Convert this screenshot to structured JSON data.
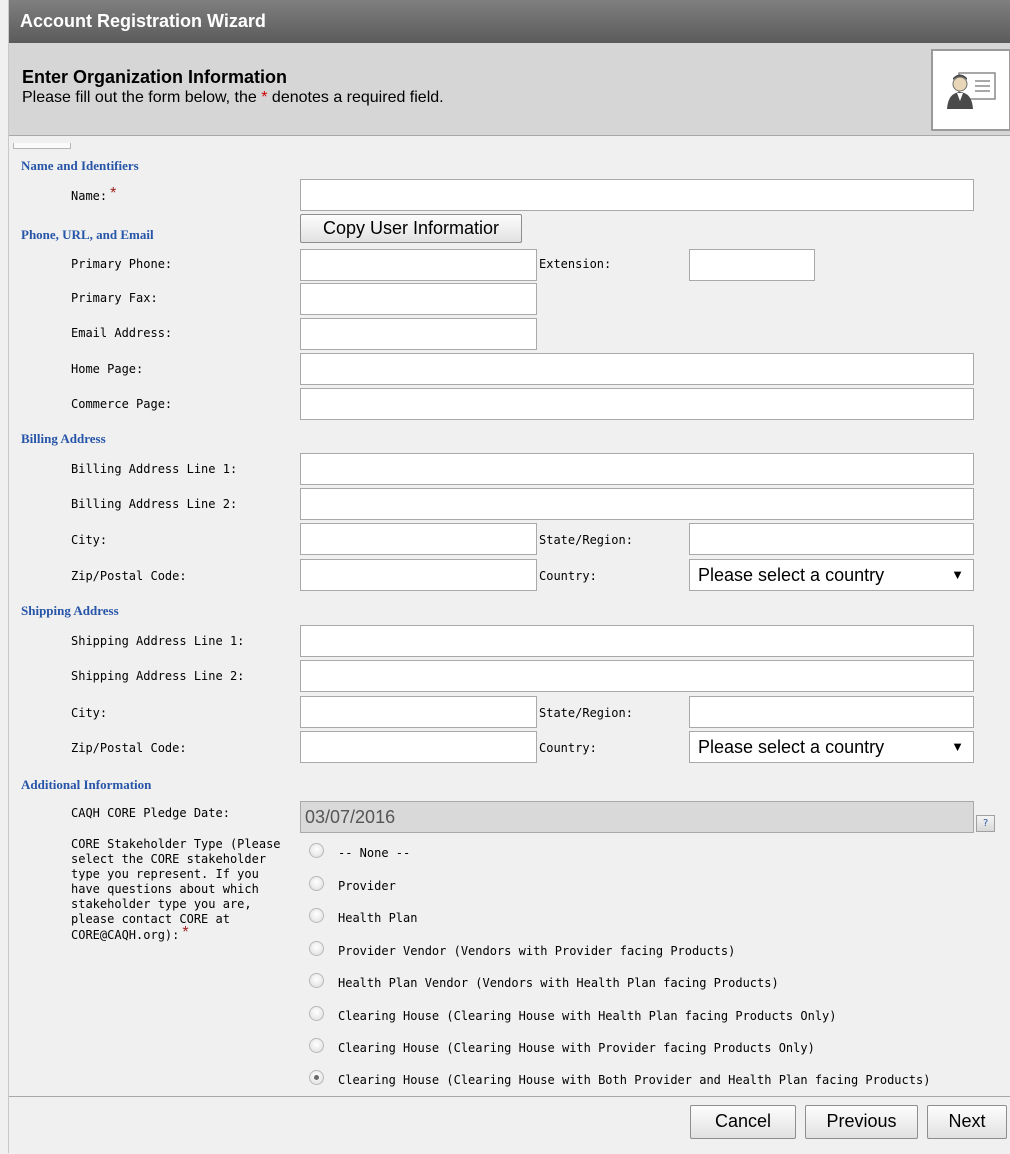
{
  "window": {
    "title": "Account Registration Wizard"
  },
  "header": {
    "title": "Enter Organization Information",
    "subtitle_before": "Please fill out the form below, the ",
    "subtitle_star": "*",
    "subtitle_after": " denotes a required field.",
    "icon": "user-card-icon"
  },
  "sections": {
    "names": "Name and Identifiers",
    "phone": "Phone, URL, and Email",
    "billing": "Billing Address",
    "shipping": "Shipping Address",
    "additional": "Additional Information"
  },
  "required_marker": "*",
  "fields": {
    "name": {
      "label": "Name:",
      "value": ""
    },
    "copy_button": "Copy User Informatior",
    "primary_phone": {
      "label": "Primary Phone:",
      "value": ""
    },
    "extension": {
      "label": "Extension:",
      "value": ""
    },
    "primary_fax": {
      "label": "Primary Fax:",
      "value": ""
    },
    "email": {
      "label": "Email Address:",
      "value": ""
    },
    "home_page": {
      "label": "Home Page:",
      "value": ""
    },
    "commerce_page": {
      "label": "Commerce Page:",
      "value": ""
    }
  },
  "billing": {
    "line1": {
      "label": "Billing Address Line 1:",
      "value": ""
    },
    "line2": {
      "label": "Billing Address Line 2:",
      "value": ""
    },
    "city": {
      "label": "City:",
      "value": ""
    },
    "state": {
      "label": "State/Region:",
      "value": ""
    },
    "zip": {
      "label": "Zip/Postal Code:",
      "value": ""
    },
    "country": {
      "label": "Country:",
      "value": "Please select a country"
    }
  },
  "shipping": {
    "line1": {
      "label": "Shipping Address Line 1:",
      "value": ""
    },
    "line2": {
      "label": "Shipping Address Line 2:",
      "value": ""
    },
    "city": {
      "label": "City:",
      "value": ""
    },
    "state": {
      "label": "State/Region:",
      "value": ""
    },
    "zip": {
      "label": "Zip/Postal Code:",
      "value": ""
    },
    "country": {
      "label": "Country:",
      "value": "Please select a country"
    }
  },
  "additional": {
    "pledge_label": "CAQH CORE Pledge Date:",
    "pledge_value": "03/07/2016",
    "help_icon_text": "?",
    "stakeholder_label": "CORE Stakeholder Type (Please select the CORE stakeholder type you represent. If you have questions about which stakeholder type you are, please contact CORE at CORE@CAQH.org):",
    "stakeholder_options": [
      {
        "label": "-- None --",
        "selected": false
      },
      {
        "label": "Provider",
        "selected": false
      },
      {
        "label": "Health Plan",
        "selected": false
      },
      {
        "label": "Provider Vendor (Vendors with Provider facing Products)",
        "selected": false
      },
      {
        "label": "Health Plan Vendor (Vendors with Health Plan facing Products)",
        "selected": false
      },
      {
        "label": "Clearing House (Clearing House with Health Plan facing Products Only)",
        "selected": false
      },
      {
        "label": "Clearing House (Clearing House with Provider facing Products Only)",
        "selected": false
      },
      {
        "label": "Clearing House (Clearing House with Both Provider and Health Plan facing Products)",
        "selected": true
      }
    ]
  },
  "footer": {
    "cancel": "Cancel",
    "previous": "Previous",
    "next": "Next"
  },
  "colors": {
    "section_heading": "#2755a8",
    "required": "#d20000",
    "titlebar": "#6b6b6b",
    "header_bg": "#d6d6d6"
  }
}
